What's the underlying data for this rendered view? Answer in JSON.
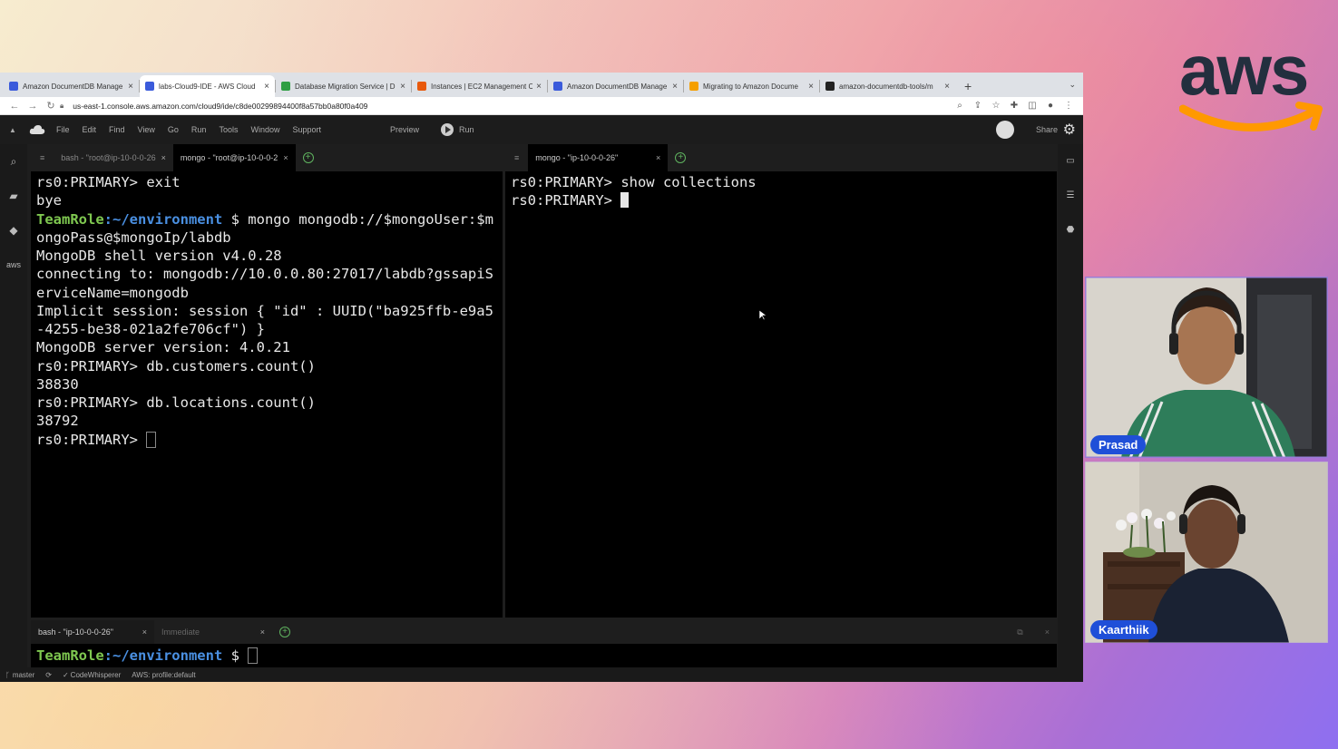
{
  "browser": {
    "tabs": [
      {
        "label": "Amazon DocumentDB Manage",
        "favicon_color": "#3b5bdb",
        "active": false
      },
      {
        "label": "labs-Cloud9-IDE - AWS Cloud",
        "favicon_color": "#3b5bdb",
        "active": true
      },
      {
        "label": "Database Migration Service | D",
        "favicon_color": "#2f9e44",
        "active": false
      },
      {
        "label": "Instances | EC2 Management C",
        "favicon_color": "#e8590c",
        "active": false
      },
      {
        "label": "Amazon DocumentDB Manage",
        "favicon_color": "#3b5bdb",
        "active": false
      },
      {
        "label": "Migrating to Amazon Docume",
        "favicon_color": "#f59f00",
        "active": false
      },
      {
        "label": "amazon-documentdb-tools/m",
        "favicon_color": "#222222",
        "active": false
      }
    ],
    "url": "us-east-1.console.aws.amazon.com/cloud9/ide/c8de00299894400f8a57bb0a80f0a409"
  },
  "ide": {
    "menu": [
      "File",
      "Edit",
      "Find",
      "View",
      "Go",
      "Run",
      "Tools",
      "Window",
      "Support"
    ],
    "preview_label": "Preview",
    "run_label": "Run",
    "share_label": "Share",
    "left_pane": {
      "tabs": [
        {
          "label": "bash - \"root@ip-10-0-0-26",
          "active": false
        },
        {
          "label": "mongo - \"root@ip-10-0-0-2",
          "active": true
        }
      ],
      "lines": [
        {
          "text": "rs0:PRIMARY> exit"
        },
        {
          "text": "bye"
        },
        {
          "prompt_role": "TeamRole",
          "prompt_path": ":~/environment",
          "text": " $ mongo mongodb://$mongoUser:$m"
        },
        {
          "text": "ongoPass@$mongoIp/labdb"
        },
        {
          "text": "MongoDB shell version v4.0.28"
        },
        {
          "text": "connecting to: mongodb://10.0.0.80:27017/labdb?gssapiS"
        },
        {
          "text": "erviceName=mongodb"
        },
        {
          "text": "Implicit session: session { \"id\" : UUID(\"ba925ffb-e9a5"
        },
        {
          "text": "-4255-be38-021a2fe706cf\") }"
        },
        {
          "text": "MongoDB server version: 4.0.21"
        },
        {
          "text": "rs0:PRIMARY> db.customers.count()"
        },
        {
          "text": "38830"
        },
        {
          "text": "rs0:PRIMARY> db.locations.count()"
        },
        {
          "text": "38792"
        },
        {
          "text": "rs0:PRIMARY> "
        }
      ]
    },
    "right_pane": {
      "tab_label": "mongo - \"ip-10-0-0-26\"",
      "lines": [
        "rs0:PRIMARY> show collections",
        "rs0:PRIMARY> "
      ]
    },
    "bottom_pane": {
      "tabs": [
        {
          "label": "bash - \"ip-10-0-0-26\"",
          "active": true
        },
        {
          "label": "Immediate",
          "active": false
        }
      ],
      "prompt_role": "TeamRole",
      "prompt_path": ":~/environment",
      "prompt_suffix": " $ "
    },
    "status": [
      "master",
      "CodeWhisperer",
      "AWS: profile:default"
    ]
  },
  "participants": [
    {
      "name": "Prasad"
    },
    {
      "name": "Kaarthiik"
    }
  ],
  "aws_logo_text": "aws"
}
